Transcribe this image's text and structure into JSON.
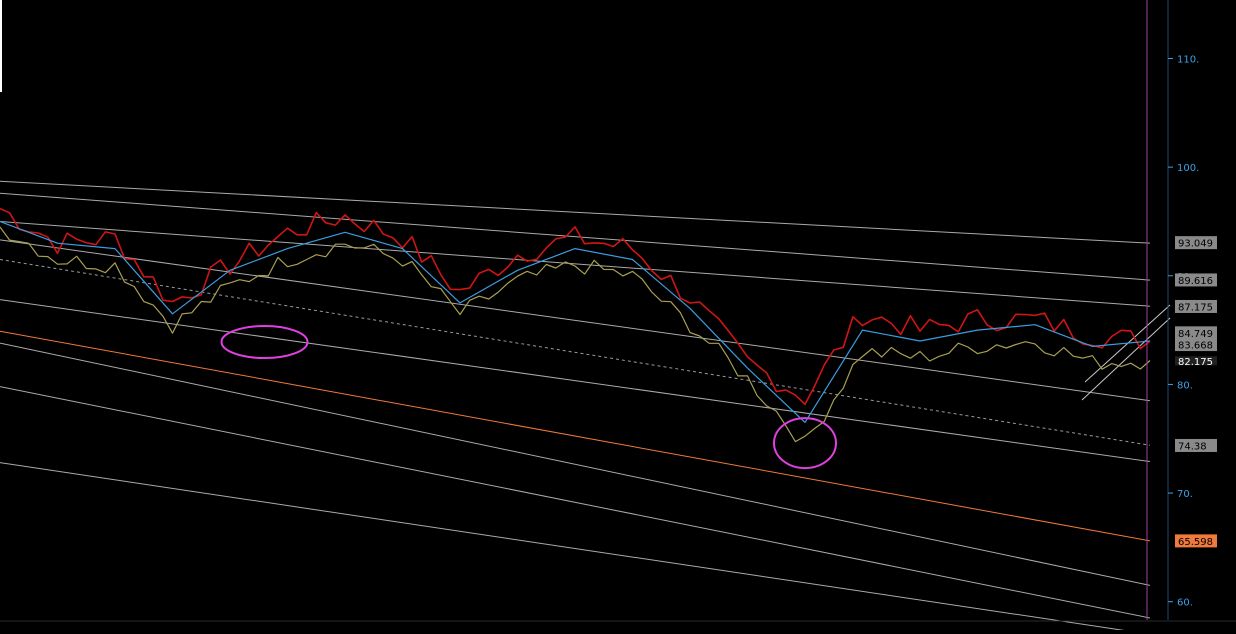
{
  "colors": {
    "background": "#000000",
    "axis_text": "#3fa0e8",
    "price_bar": "#d01515",
    "close_line": "#a8a050",
    "trend_line": "#3a9de0",
    "channel_line": "#c8c8c8",
    "support_line": "#f07a3c",
    "highlight_circle": "#e040e0",
    "vertical_marker": "#a040a0",
    "label_box_gray": "#8a8a8a",
    "label_box_orange": "#f07a3c"
  },
  "chart_data": {
    "type": "line",
    "title": "",
    "xlabel": "",
    "ylabel": "",
    "ylim": [
      58.5,
      115.2
    ],
    "y_ticks": [
      60,
      70,
      80,
      90,
      100,
      110
    ],
    "y_tick_labels": [
      "60.",
      "70.",
      "80.",
      "90.",
      "100.",
      "110."
    ],
    "grid": false,
    "x": [
      0,
      5,
      10,
      15,
      20,
      25,
      30,
      35,
      40,
      45,
      50,
      55,
      60,
      65,
      70,
      75,
      80,
      85,
      90,
      95,
      100
    ],
    "series": [
      {
        "style": "high",
        "values": [
          96.2,
          93.0,
          93.5,
          87.5,
          91.0,
          94.0,
          95.5,
          93.5,
          88.5,
          92.0,
          93.5,
          92.5,
          88.0,
          82.0,
          78.8,
          86.5,
          85.0,
          86.0,
          86.0,
          84.5,
          84.0
        ]
      },
      {
        "style": "close",
        "values": [
          94.5,
          91.5,
          91.0,
          85.5,
          89.0,
          91.5,
          93.0,
          91.5,
          86.5,
          89.5,
          91.0,
          90.0,
          85.5,
          80.5,
          74.5,
          83.0,
          82.5,
          83.5,
          84.0,
          82.0,
          82.2
        ]
      },
      {
        "style": "trend",
        "values": [
          95.0,
          93.0,
          92.5,
          86.5,
          90.5,
          92.5,
          94.0,
          92.5,
          87.5,
          90.5,
          92.5,
          91.5,
          87.0,
          81.5,
          76.5,
          85.0,
          84.0,
          85.0,
          85.5,
          83.5,
          84.0
        ]
      }
    ],
    "trendlines": [
      {
        "style": "solid",
        "y_start": 93.3,
        "y_end": 78.5
      },
      {
        "style": "solid",
        "y_start": 87.8,
        "y_end": 72.9
      },
      {
        "style": "solid",
        "y_start": 83.8,
        "y_end": 61.5
      },
      {
        "style": "solid",
        "y_start": 79.8,
        "y_end": 58.5
      },
      {
        "style": "solid",
        "y_start": 72.8,
        "y_end": 57.0
      },
      {
        "style": "dashed",
        "y_start": 91.5,
        "y_end": 74.4
      },
      {
        "style": "solid",
        "y_start": 98.7,
        "y_end": 93.0
      },
      {
        "style": "solid",
        "y_start": 97.6,
        "y_end": 89.6
      },
      {
        "style": "solid",
        "y_start": 95.0,
        "y_end": 87.2
      },
      {
        "style": "orange",
        "y_start": 84.9,
        "y_end": 65.6
      }
    ],
    "price_labels": [
      {
        "text": "93.049",
        "value": 93.049,
        "style": "gray"
      },
      {
        "text": "89.616",
        "value": 89.616,
        "style": "gray"
      },
      {
        "text": "87.175",
        "value": 87.175,
        "style": "gray"
      },
      {
        "text": "84.749",
        "value": 84.749,
        "style": "gray"
      },
      {
        "text": "83.668",
        "value": 83.668,
        "style": "gray"
      },
      {
        "text": "82.175",
        "value": 82.175,
        "style": "dark"
      },
      {
        "text": "74.38",
        "value": 74.38,
        "style": "gray"
      },
      {
        "text": "65.598",
        "value": 65.598,
        "style": "orange"
      }
    ],
    "highlights": [
      {
        "x": 23,
        "y": 83.9
      },
      {
        "x": 70,
        "y": 74.6
      }
    ]
  }
}
